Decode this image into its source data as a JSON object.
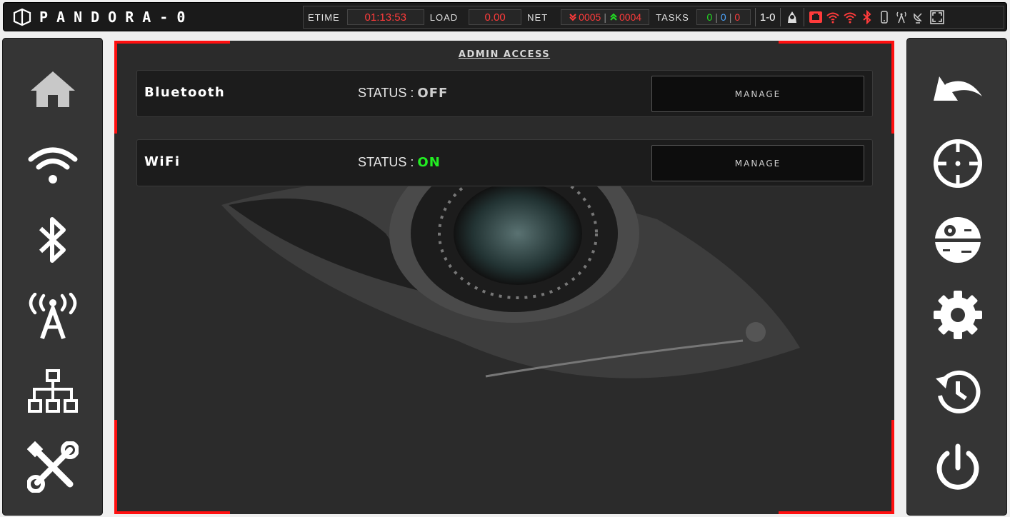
{
  "app": {
    "title": "PANDORA-0",
    "brand_text": "PANDORA-0"
  },
  "status_bar": {
    "etime_label": "ETIME",
    "etime_value": "01:13:53",
    "load_label": "LOAD",
    "load_value": "0.00",
    "net_label": "NET",
    "net_down": "0005",
    "net_sep": "|",
    "net_up": "0004",
    "tasks_label": "TASKS",
    "tasks": [
      "0",
      "0",
      "0"
    ],
    "tasks_sep": "|",
    "mode": "1-0",
    "accent": "#ff1010",
    "good": "#22dd22"
  },
  "left_nav": [
    {
      "name": "home",
      "icon": "home-icon"
    },
    {
      "name": "wifi",
      "icon": "wifi-icon"
    },
    {
      "name": "bluetooth",
      "icon": "bluetooth-icon"
    },
    {
      "name": "radio-tower",
      "icon": "radio-tower-icon"
    },
    {
      "name": "network",
      "icon": "network-icon"
    },
    {
      "name": "tools",
      "icon": "tools-icon"
    }
  ],
  "right_nav": [
    {
      "name": "back",
      "icon": "undo-icon"
    },
    {
      "name": "target",
      "icon": "crosshair-icon"
    },
    {
      "name": "death-star",
      "icon": "death-star-icon"
    },
    {
      "name": "settings",
      "icon": "gear-icon"
    },
    {
      "name": "history",
      "icon": "history-icon"
    },
    {
      "name": "power",
      "icon": "power-icon"
    }
  ],
  "main": {
    "title": "ADMIN ACCESS",
    "rows": [
      {
        "name": "Bluetooth",
        "status_label": "STATUS",
        "status_sep": ":",
        "status_value": "OFF",
        "status_color": "#cfcfcf",
        "button": "MANAGE"
      },
      {
        "name": "WiFi",
        "status_label": "STATUS",
        "status_sep": ":",
        "status_value": "ON",
        "status_color": "#22ee22",
        "button": "MANAGE"
      }
    ]
  }
}
